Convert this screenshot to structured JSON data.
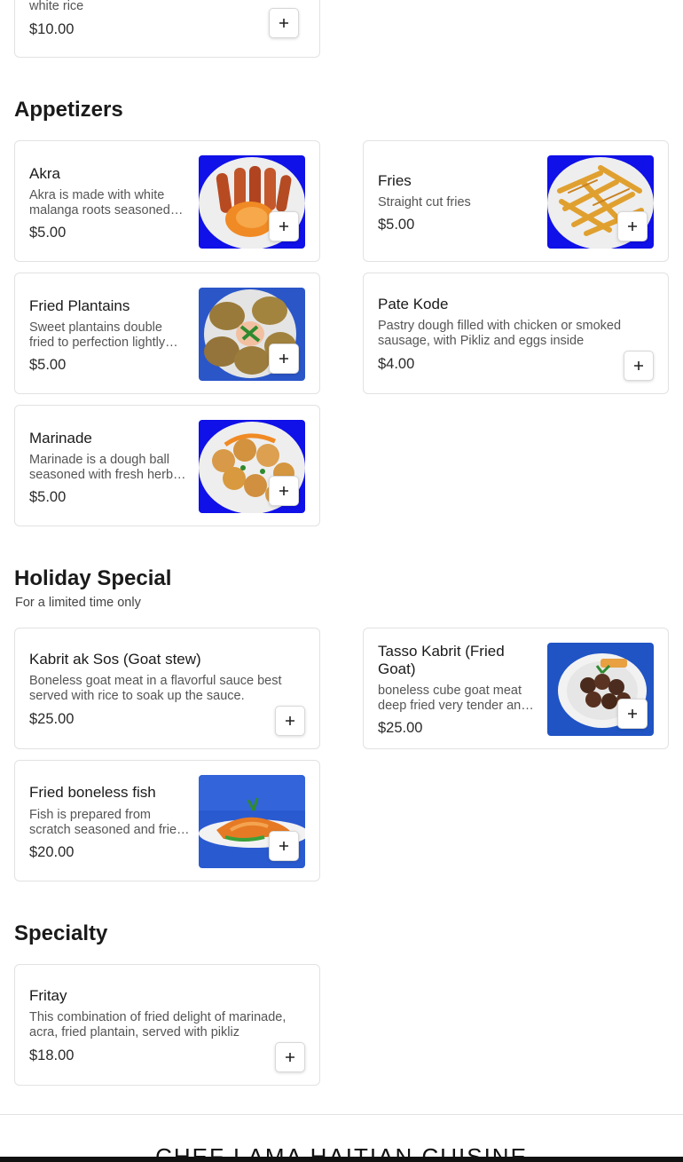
{
  "partial_item": {
    "desc_tail": "white rice",
    "price": "$10.00"
  },
  "appetizers": {
    "title": "Appetizers",
    "items": [
      {
        "name": "Akra",
        "desc": "Akra is made with white malanga roots seasoned with spices and herbs",
        "price": "$5.00"
      },
      {
        "name": "Fries",
        "desc": "Straight cut fries",
        "price": "$5.00"
      },
      {
        "name": "Fried Plantains",
        "desc": "Sweet plantains double fried to perfection lightly salted",
        "price": "$5.00"
      },
      {
        "name": "Pate Kode",
        "desc": "Pastry dough filled with chicken or smoked sausage, with Pikliz and eggs inside",
        "price": "$4.00"
      },
      {
        "name": "Marinade",
        "desc": "Marinade is a dough ball seasoned with fresh herbs and fried",
        "price": "$5.00"
      }
    ]
  },
  "holiday": {
    "title": "Holiday Special",
    "subtitle": "For a limited time only",
    "items": [
      {
        "name": "Kabrit ak Sos (Goat stew)",
        "desc": "Boneless goat meat in a flavorful sauce best served with rice to soak up the sauce.",
        "price": "$25.00"
      },
      {
        "name": "Tasso Kabrit (Fried Goat)",
        "desc": "boneless cube goat meat deep fried very tender and seasoned",
        "price": "$25.00"
      },
      {
        "name": "Fried boneless fish",
        "desc": "Fish is prepared from scratch seasoned and fried until golden",
        "price": "$20.00"
      }
    ]
  },
  "specialty": {
    "title": "Specialty",
    "items": [
      {
        "name": "Fritay",
        "desc": "This combination of fried delight of marinade, acra, fried plantain, served with pikliz",
        "price": "$18.00"
      }
    ]
  },
  "footer": {
    "title": "CHEF LAMA HAITIAN CUISINE"
  },
  "colors": {
    "image_backdrop": "#1010e8",
    "border": "#e2e2e2",
    "text": "#1a1a1a"
  }
}
